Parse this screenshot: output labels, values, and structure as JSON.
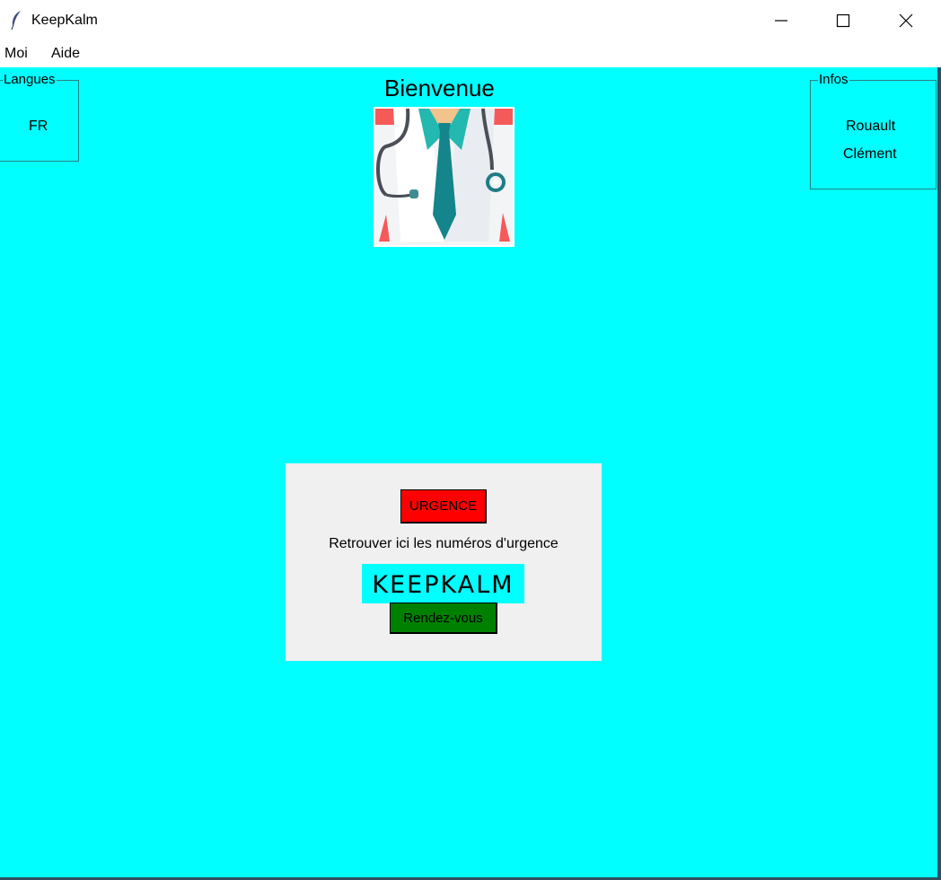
{
  "window": {
    "title": "KeepKalm",
    "icon": "feather-icon",
    "controls": [
      "minimize-icon",
      "maximize-icon",
      "close-icon"
    ]
  },
  "menubar": {
    "items": [
      "Moi",
      "Aide"
    ]
  },
  "content": {
    "background": "#00ffff",
    "heading": "Bienvenue",
    "image": "doctor-illustration"
  },
  "langues": {
    "legend": "Langues",
    "value": "FR"
  },
  "infos": {
    "legend": "Infos",
    "line1": "Rouault",
    "line2": "Clément"
  },
  "panel": {
    "background": "#f0f0f0",
    "urgence_label": "URGENCE",
    "urgence_color": "#ff0000",
    "info_text": "Retrouver ici les numéros d'urgence",
    "logo_text": "KEEPKALM",
    "rdv_label": "Rendez-vous",
    "rdv_color": "#008000"
  }
}
